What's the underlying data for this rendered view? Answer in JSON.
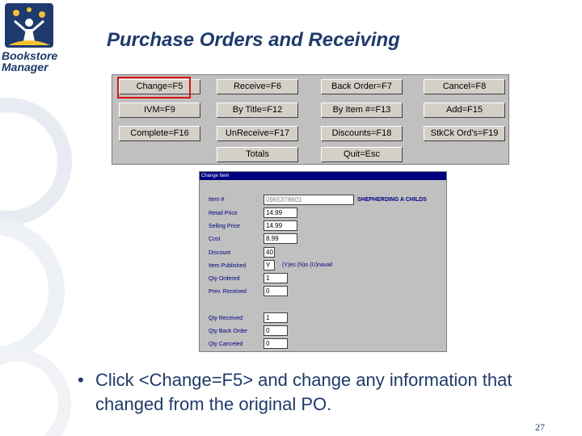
{
  "logo": {
    "line1": "Bookstore",
    "line2": "Manager"
  },
  "slide": {
    "title": "Purchase Orders and Receiving",
    "page_number": "27"
  },
  "toolbar": {
    "buttons": [
      "Change=F5",
      "Receive=F6",
      "Back Order=F7",
      "Cancel=F8",
      "IVM=F9",
      "By Title=F12",
      "By Item #=F13",
      "Add=F15",
      "Complete=F16",
      "UnReceive=F17",
      "Discounts=F18",
      "StkCk Ord's=F19",
      "Totals",
      "Quit=Esc"
    ]
  },
  "dialog": {
    "title": "Change Item",
    "item_label": "Item #",
    "item_value": "0965378601",
    "item_desc": "SHEPHERDING A CHILDS",
    "retail_label": "Retail Price",
    "retail_value": "14.99",
    "selling_label": "Selling Price",
    "selling_value": "14.99",
    "cost_label": "Cost",
    "cost_value": "8.99",
    "discount_label": "Discount",
    "discount_value": "40",
    "published_label": "Item Published",
    "published_value": "Y",
    "published_note": "(Y)es (N)o (U)navail",
    "ordered_label": "Qty Ordered",
    "ordered_value": "1",
    "prev_label": "Prev. Received",
    "prev_value": "0",
    "received_label": "Qty Received",
    "received_value": "1",
    "backorder_label": "Qty Back Order",
    "backorder_value": "0",
    "canceled_label": "Qty Canceled",
    "canceled_value": "0"
  },
  "bullet": {
    "symbol": "•",
    "text": "Click <Change=F5> and change any information that changed from the original PO."
  },
  "colors": {
    "title": "#1e3a6e",
    "highlight": "#e01010",
    "dialog_label": "#000080"
  }
}
